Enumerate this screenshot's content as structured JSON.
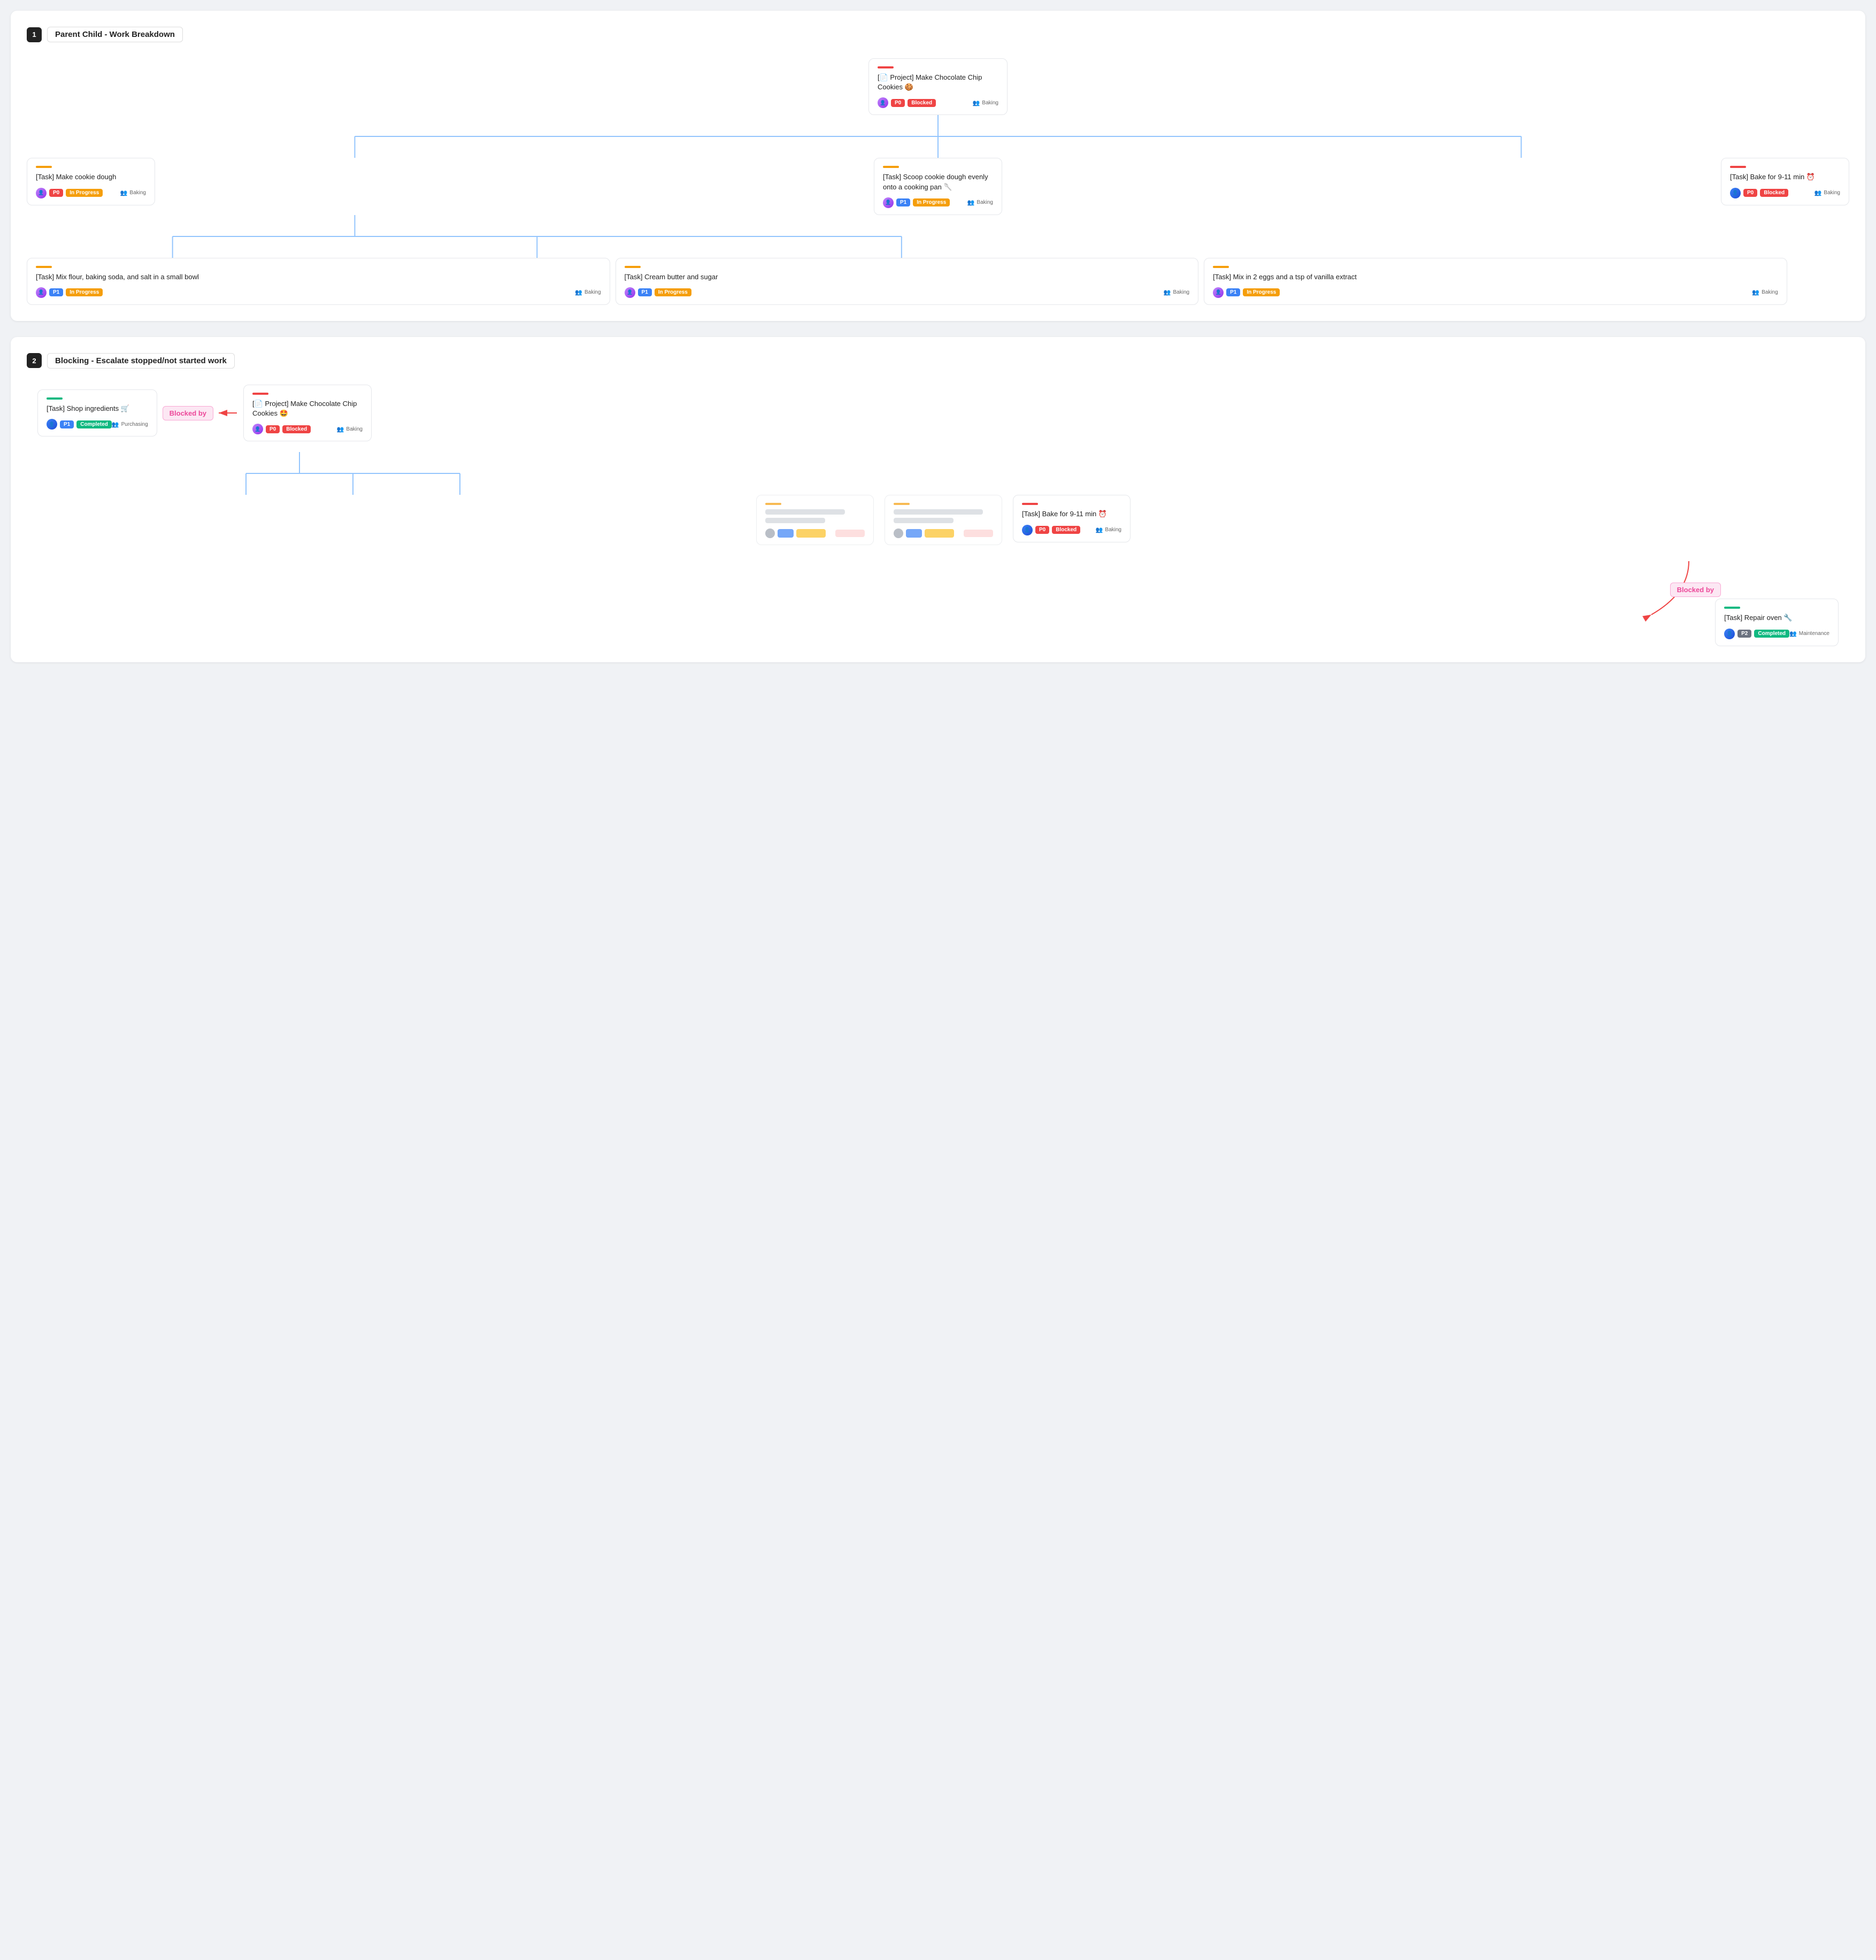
{
  "section1": {
    "number": "1",
    "title": "Parent Child - Work Breakdown",
    "root": {
      "accent": "#ef4444",
      "title": "[📄 Project] Make Chocolate Chip Cookies 🍪",
      "priority": "P0",
      "status": "Blocked",
      "status_class": "badge-blocked",
      "team": "Baking",
      "avatar": "avatar-purple"
    },
    "level1": [
      {
        "accent": "#f59e0b",
        "title": "[Task] Make cookie dough",
        "priority": "P0",
        "status": "In Progress",
        "status_class": "badge-inprogress",
        "team": "Baking",
        "avatar": "avatar-purple"
      },
      {
        "accent": "#f59e0b",
        "title": "[Task] Scoop cookie dough evenly onto a cooking pan 🥄",
        "priority": "P1",
        "status": "In Progress",
        "status_class": "badge-inprogress",
        "team": "Baking",
        "avatar": "avatar-purple"
      },
      {
        "accent": "#ef4444",
        "title": "[Task] Bake for 9-11 min ⏰",
        "priority": "P0",
        "status": "Blocked",
        "status_class": "badge-blocked",
        "team": "Baking",
        "avatar": "avatar-blue"
      }
    ],
    "level2": [
      {
        "accent": "#f59e0b",
        "title": "[Task] Mix flour, baking soda, and salt in a small bowl",
        "priority": "P1",
        "status": "In Progress",
        "status_class": "badge-inprogress",
        "team": "Baking",
        "avatar": "avatar-purple"
      },
      {
        "accent": "#f59e0b",
        "title": "[Task] Cream butter and sugar",
        "priority": "P1",
        "status": "In Progress",
        "status_class": "badge-inprogress",
        "team": "Baking",
        "avatar": "avatar-purple"
      },
      {
        "accent": "#f59e0b",
        "title": "[Task] Mix in 2 eggs and a tsp of vanilla extract",
        "priority": "P1",
        "status": "In Progress",
        "status_class": "badge-inprogress",
        "team": "Baking",
        "avatar": "avatar-purple"
      }
    ]
  },
  "section2": {
    "number": "2",
    "title": "Blocking - Escalate stopped/not started work",
    "shop": {
      "accent": "#10b981",
      "title": "[Task] Shop ingredients 🛒",
      "priority": "P1",
      "status": "Completed",
      "status_class": "badge-completed",
      "team": "Purchasing",
      "avatar": "avatar-blue"
    },
    "blocked_by_label": "Blocked by",
    "root": {
      "accent": "#ef4444",
      "title": "[📄 Project] Make Chocolate Chip Cookies 🤩",
      "priority": "P0",
      "status": "Blocked",
      "status_class": "badge-blocked",
      "team": "Baking",
      "avatar": "avatar-purple"
    },
    "bake": {
      "accent": "#ef4444",
      "title": "[Task] Bake for 9-11 min ⏰",
      "priority": "P0",
      "status": "Blocked",
      "status_class": "badge-blocked",
      "team": "Baking",
      "avatar": "avatar-blue"
    },
    "repair": {
      "accent": "#10b981",
      "title": "[Task] Repair oven 🔧",
      "priority": "P2",
      "status": "Completed",
      "status_class": "badge-completed",
      "team": "Maintenance",
      "avatar": "avatar-blue"
    },
    "blocked_by_label2": "Blocked by"
  },
  "badges": {
    "p0": "P0",
    "p1": "P1",
    "p2": "P2",
    "blocked": "Blocked",
    "in_progress": "In Progress",
    "completed": "Completed"
  }
}
